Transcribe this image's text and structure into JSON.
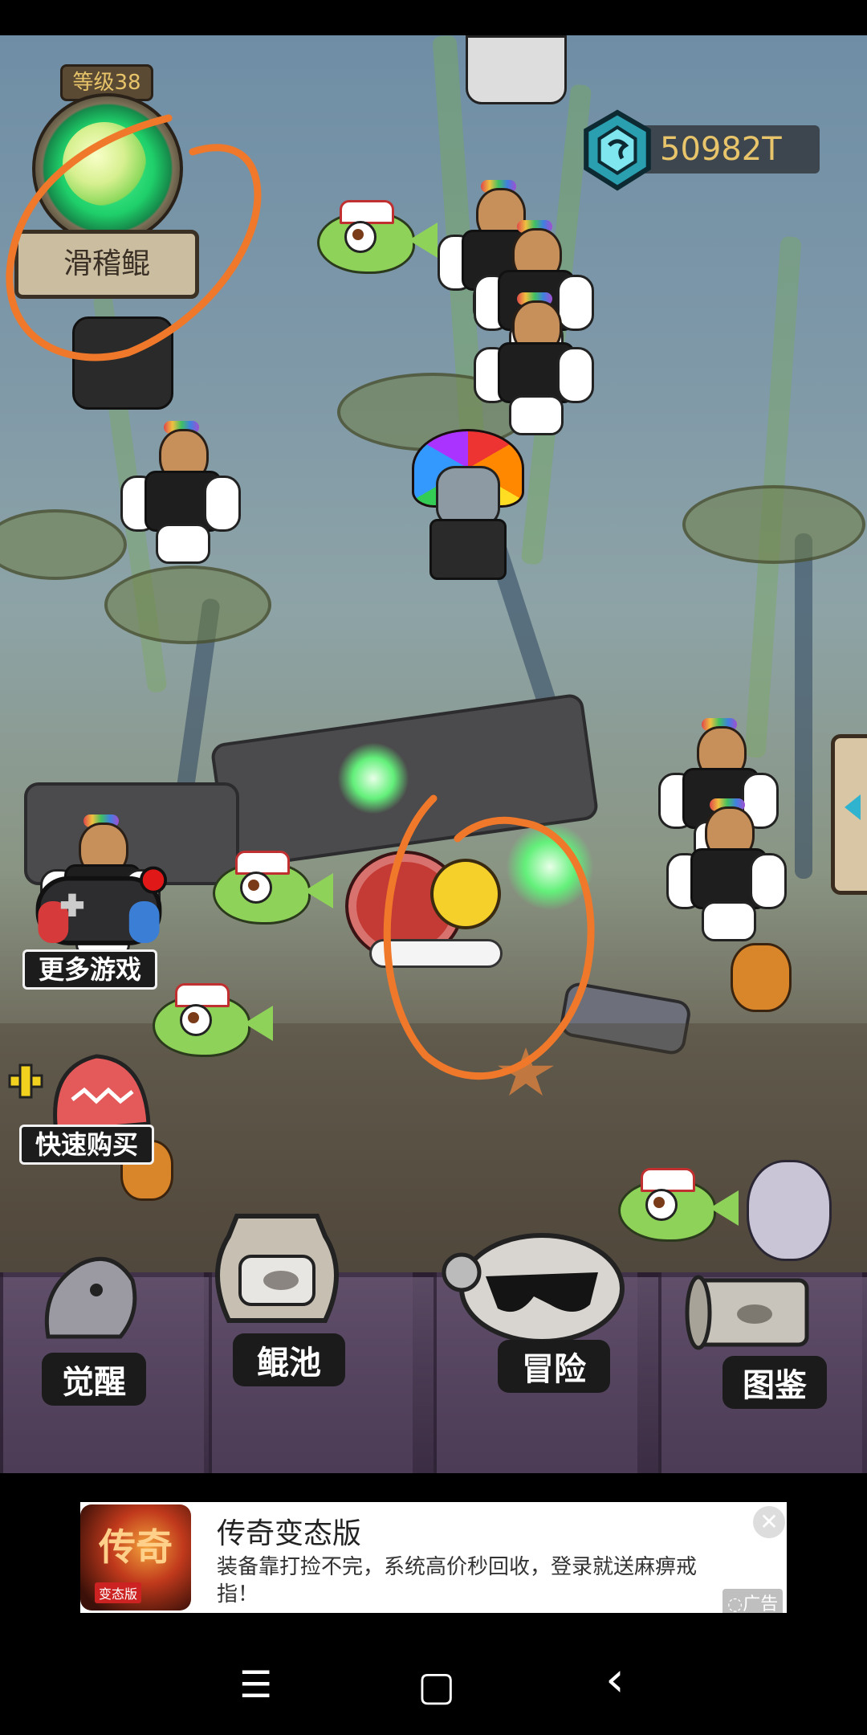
{
  "player": {
    "level_label": "等级38",
    "pet_name": "滑稽鲲"
  },
  "currency": {
    "value": "50982T",
    "icon": "blue-gem-icon"
  },
  "side_buttons": {
    "more_games": "更多游戏",
    "quick_buy": "快速购买"
  },
  "nav": {
    "items": [
      {
        "label": "觉醒",
        "icon": "awaken-statue-icon"
      },
      {
        "label": "鲲池",
        "icon": "fish-jar-icon"
      },
      {
        "label": "冒险",
        "icon": "sunglasses-skull-icon"
      },
      {
        "label": "图鉴",
        "icon": "scroll-map-icon"
      }
    ]
  },
  "ad": {
    "icon_text": "传奇",
    "icon_sub": "变态版",
    "title": "传奇变态版",
    "description": "装备靠打捡不完，系统高价秒回收，登录就送麻痹戒指！",
    "tag": "◌广告",
    "close": "✕"
  },
  "system_nav": {
    "menu": "☰",
    "home": "▢",
    "back": "‹"
  },
  "colors": {
    "accent": "#e8c46a",
    "annotation": "#f0782a"
  }
}
